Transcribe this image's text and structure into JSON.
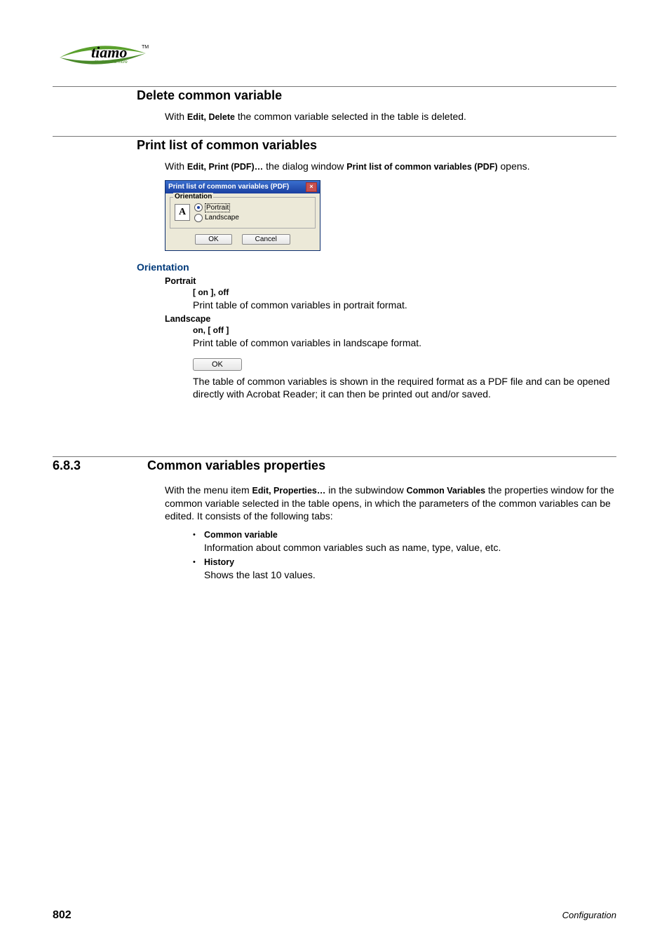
{
  "logo": {
    "text": "tiamo",
    "tm": "TM",
    "sub": "titration and more"
  },
  "section1": {
    "title": "Delete common variable",
    "body_pre": "With ",
    "body_bold": "Edit, Delete",
    "body_post": " the common variable selected in the table is deleted."
  },
  "section2": {
    "title": "Print list of common variables",
    "body_pre": "With ",
    "body_bold1": "Edit, Print (PDF)…",
    "body_mid": " the dialog window ",
    "body_bold2": "Print list of common variables (PDF)",
    "body_post": " opens."
  },
  "dialog": {
    "title": "Print list of common variables (PDF)",
    "legend": "Orientation",
    "iconA": "A",
    "opt1": "Portrait",
    "opt2": "Landscape",
    "ok": "OK",
    "cancel": "Cancel"
  },
  "orientation": {
    "heading": "Orientation",
    "portrait": {
      "term": "Portrait",
      "sub": "[ on ], off",
      "body": "Print table of common variables in portrait format."
    },
    "landscape": {
      "term": "Landscape",
      "sub": "on, [ off ]",
      "body": "Print table of common variables in landscape format."
    },
    "ok_label": "OK",
    "ok_body": "The table of common variables is shown in the required format as a PDF file and can be opened directly with Acrobat Reader; it can then be printed out and/or saved."
  },
  "section3": {
    "number": "6.8.3",
    "title": "Common variables properties",
    "body_pre": "With the menu item ",
    "body_bold1": "Edit, Properties…",
    "body_mid": "  in the subwindow ",
    "body_bold2": "Common Variables",
    "body_post": " the properties window for the common variable selected in the table opens, in which the parameters of the common variables can be edited. It consists of the following tabs:"
  },
  "bullets": {
    "item1": {
      "head": "Common variable",
      "body": "Information about common variables such as name, type, value, etc."
    },
    "item2": {
      "head": "History",
      "body": "Shows the last 10 values."
    }
  },
  "footer": {
    "page": "802",
    "right": "Configuration"
  }
}
